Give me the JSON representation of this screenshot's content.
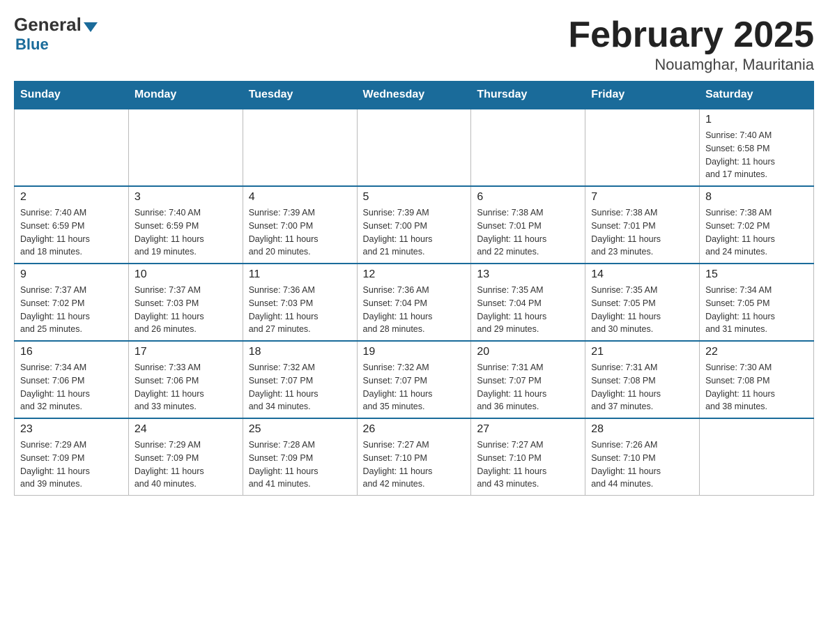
{
  "logo": {
    "general": "General",
    "blue": "Blue"
  },
  "title": "February 2025",
  "location": "Nouamghar, Mauritania",
  "days_of_week": [
    "Sunday",
    "Monday",
    "Tuesday",
    "Wednesday",
    "Thursday",
    "Friday",
    "Saturday"
  ],
  "weeks": [
    [
      {
        "day": "",
        "info": ""
      },
      {
        "day": "",
        "info": ""
      },
      {
        "day": "",
        "info": ""
      },
      {
        "day": "",
        "info": ""
      },
      {
        "day": "",
        "info": ""
      },
      {
        "day": "",
        "info": ""
      },
      {
        "day": "1",
        "info": "Sunrise: 7:40 AM\nSunset: 6:58 PM\nDaylight: 11 hours\nand 17 minutes."
      }
    ],
    [
      {
        "day": "2",
        "info": "Sunrise: 7:40 AM\nSunset: 6:59 PM\nDaylight: 11 hours\nand 18 minutes."
      },
      {
        "day": "3",
        "info": "Sunrise: 7:40 AM\nSunset: 6:59 PM\nDaylight: 11 hours\nand 19 minutes."
      },
      {
        "day": "4",
        "info": "Sunrise: 7:39 AM\nSunset: 7:00 PM\nDaylight: 11 hours\nand 20 minutes."
      },
      {
        "day": "5",
        "info": "Sunrise: 7:39 AM\nSunset: 7:00 PM\nDaylight: 11 hours\nand 21 minutes."
      },
      {
        "day": "6",
        "info": "Sunrise: 7:38 AM\nSunset: 7:01 PM\nDaylight: 11 hours\nand 22 minutes."
      },
      {
        "day": "7",
        "info": "Sunrise: 7:38 AM\nSunset: 7:01 PM\nDaylight: 11 hours\nand 23 minutes."
      },
      {
        "day": "8",
        "info": "Sunrise: 7:38 AM\nSunset: 7:02 PM\nDaylight: 11 hours\nand 24 minutes."
      }
    ],
    [
      {
        "day": "9",
        "info": "Sunrise: 7:37 AM\nSunset: 7:02 PM\nDaylight: 11 hours\nand 25 minutes."
      },
      {
        "day": "10",
        "info": "Sunrise: 7:37 AM\nSunset: 7:03 PM\nDaylight: 11 hours\nand 26 minutes."
      },
      {
        "day": "11",
        "info": "Sunrise: 7:36 AM\nSunset: 7:03 PM\nDaylight: 11 hours\nand 27 minutes."
      },
      {
        "day": "12",
        "info": "Sunrise: 7:36 AM\nSunset: 7:04 PM\nDaylight: 11 hours\nand 28 minutes."
      },
      {
        "day": "13",
        "info": "Sunrise: 7:35 AM\nSunset: 7:04 PM\nDaylight: 11 hours\nand 29 minutes."
      },
      {
        "day": "14",
        "info": "Sunrise: 7:35 AM\nSunset: 7:05 PM\nDaylight: 11 hours\nand 30 minutes."
      },
      {
        "day": "15",
        "info": "Sunrise: 7:34 AM\nSunset: 7:05 PM\nDaylight: 11 hours\nand 31 minutes."
      }
    ],
    [
      {
        "day": "16",
        "info": "Sunrise: 7:34 AM\nSunset: 7:06 PM\nDaylight: 11 hours\nand 32 minutes."
      },
      {
        "day": "17",
        "info": "Sunrise: 7:33 AM\nSunset: 7:06 PM\nDaylight: 11 hours\nand 33 minutes."
      },
      {
        "day": "18",
        "info": "Sunrise: 7:32 AM\nSunset: 7:07 PM\nDaylight: 11 hours\nand 34 minutes."
      },
      {
        "day": "19",
        "info": "Sunrise: 7:32 AM\nSunset: 7:07 PM\nDaylight: 11 hours\nand 35 minutes."
      },
      {
        "day": "20",
        "info": "Sunrise: 7:31 AM\nSunset: 7:07 PM\nDaylight: 11 hours\nand 36 minutes."
      },
      {
        "day": "21",
        "info": "Sunrise: 7:31 AM\nSunset: 7:08 PM\nDaylight: 11 hours\nand 37 minutes."
      },
      {
        "day": "22",
        "info": "Sunrise: 7:30 AM\nSunset: 7:08 PM\nDaylight: 11 hours\nand 38 minutes."
      }
    ],
    [
      {
        "day": "23",
        "info": "Sunrise: 7:29 AM\nSunset: 7:09 PM\nDaylight: 11 hours\nand 39 minutes."
      },
      {
        "day": "24",
        "info": "Sunrise: 7:29 AM\nSunset: 7:09 PM\nDaylight: 11 hours\nand 40 minutes."
      },
      {
        "day": "25",
        "info": "Sunrise: 7:28 AM\nSunset: 7:09 PM\nDaylight: 11 hours\nand 41 minutes."
      },
      {
        "day": "26",
        "info": "Sunrise: 7:27 AM\nSunset: 7:10 PM\nDaylight: 11 hours\nand 42 minutes."
      },
      {
        "day": "27",
        "info": "Sunrise: 7:27 AM\nSunset: 7:10 PM\nDaylight: 11 hours\nand 43 minutes."
      },
      {
        "day": "28",
        "info": "Sunrise: 7:26 AM\nSunset: 7:10 PM\nDaylight: 11 hours\nand 44 minutes."
      },
      {
        "day": "",
        "info": ""
      }
    ]
  ]
}
